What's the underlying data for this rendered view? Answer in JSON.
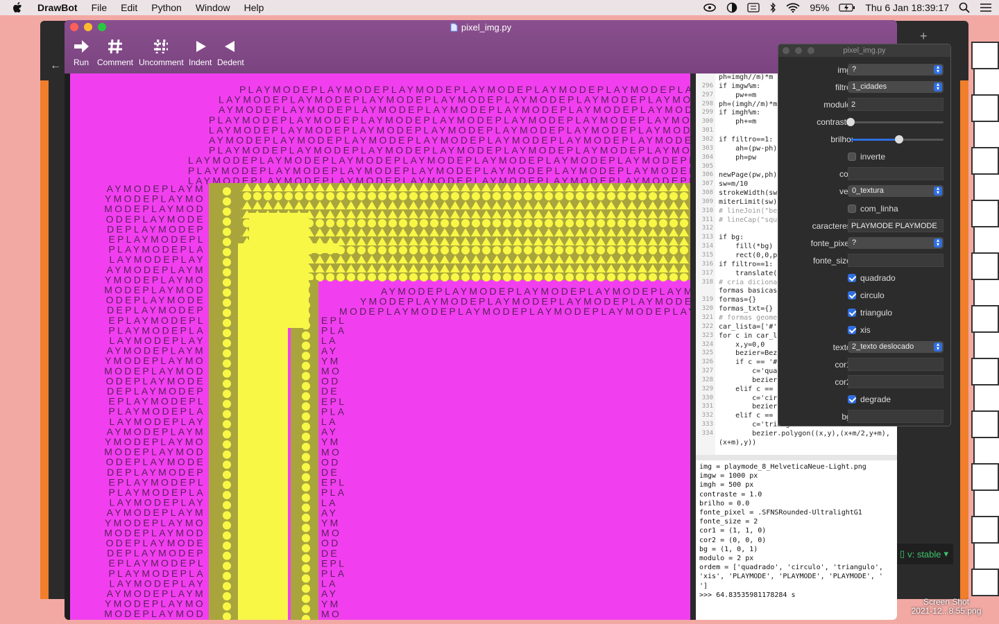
{
  "menubar": {
    "app": "DrawBot",
    "items": [
      "File",
      "Edit",
      "Python",
      "Window",
      "Help"
    ],
    "battery": "95%",
    "clock": "Thu 6 Jan  18:39:17"
  },
  "window": {
    "title": "pixel_img.py",
    "toolbar": [
      {
        "label": "Run",
        "icon": "run-arrow-icon"
      },
      {
        "label": "Comment",
        "icon": "hash-icon"
      },
      {
        "label": "Uncomment",
        "icon": "uncomment-hash-icon"
      },
      {
        "label": "Indent",
        "icon": "indent-triangle-icon"
      },
      {
        "label": "Dedent",
        "icon": "dedent-triangle-icon"
      }
    ]
  },
  "canvas": {
    "text": "PLAYMODE",
    "bg_color": "#f13ff0",
    "shape_color": "#f8f746",
    "olive": "#a9a53c"
  },
  "editor": {
    "line_numbers": [
      "",
      "296",
      "297",
      "298",
      "299",
      "300",
      "301",
      "302",
      "303",
      "304",
      "305",
      "306",
      "307",
      "308",
      "309",
      "310",
      "311",
      "312",
      "313",
      "314",
      "315",
      "316",
      "317",
      "318",
      "",
      "319",
      "320",
      "321",
      "322",
      "323",
      "324",
      "325",
      "326",
      "327",
      "328",
      "329",
      "330",
      "331",
      "332",
      "333",
      "334",
      ""
    ],
    "lines": [
      "ph=imgh//m)*m",
      "if imgw%m:",
      "    pw+=m",
      "ph=(imgh//m)*m",
      "if imgh%m:",
      "    ph+=m",
      "",
      "if filtro==1:",
      "    ah=(pw-ph)",
      "    ph=pw",
      "",
      "newPage(pw,ph)",
      "sw=m/10",
      "strokeWidth(sw",
      "miterLimit(sw)",
      "# lineJoin(\"be",
      "# lineCap(\"squ",
      "",
      "if bg:",
      "    fill(*bg)",
      "    rect(0,0,p",
      "if filtro==1:",
      "    translate(",
      "# cria diciona",
      "formas basicas",
      "formas={}",
      "formas_txt={}",
      "# formas geome",
      "car_lista=['#'",
      "for c in car_l",
      "    x,y=0,0",
      "    bezier=Bez",
      "    if c == '#",
      "        c='qua",
      "        bezier",
      "    elif c ==",
      "        c='cir",
      "        bezier",
      "    elif c ==",
      "        c='triangulo'",
      "        bezier.polygon((x,y),(x+m/2,y+m),",
      "(x+m),y))"
    ]
  },
  "output": [
    "img = playmode_8_HelveticaNeue-Light.png",
    "imgw = 1000 px",
    "imgh = 500 px",
    "contraste = 1.0",
    "brilho = 0.0",
    "fonte_pixel = .SFNSRounded-UltralightG1",
    "fonte_size = 2",
    "cor1 = (1, 1, 0)",
    "cor2 = (0, 0, 0)",
    "bg = (1, 0, 1)",
    "modulo = 2 px",
    "ordem = ['quadrado', 'circulo', 'triangulo',",
    "'xis', 'PLAYMODE', 'PLAYMODE', 'PLAYMODE', '",
    "']",
    ">>> 64.83535981178284 s"
  ],
  "panel": {
    "title": "pixel_img.py",
    "img_label": "img:",
    "img_value": "?",
    "filtro_label": "filtro:",
    "filtro_value": "1_cidades",
    "modulo_label": "modulo:",
    "modulo_value": "2",
    "contraste_label": "contraste:",
    "contraste_level": 0.0,
    "brilho_label": "brilho:",
    "brilho_level": 0.52,
    "inverte_label": "inverte",
    "inverte_checked": false,
    "cor_label": "cor:",
    "cor_value": "",
    "ver_label": "ver:",
    "ver_value": "0_textura",
    "com_linha_label": "com_linha",
    "com_linha_checked": false,
    "caracteres_label": "caracteres:",
    "caracteres_value": "PLAYMODE PLAYMODE",
    "fonte_pixel_label": "fonte_pixel:",
    "fonte_pixel_value": "?",
    "fonte_size_label": "fonte_size:",
    "fonte_size_value": "",
    "quadrado_label": "quadrado",
    "quadrado_checked": true,
    "circulo_label": "circulo",
    "circulo_checked": true,
    "triangulo_label": "triangulo",
    "triangulo_checked": true,
    "xis_label": "xis",
    "xis_checked": true,
    "texto_label": "texto:",
    "texto_value": "2_texto deslocado",
    "cor1_label": "cor1:",
    "cor1_value": "",
    "cor2_label": "cor2:",
    "cor2_value": "",
    "degrade_label": "degrade",
    "degrade_checked": true,
    "bg_label": "bg:",
    "bg_value": ""
  },
  "background": {
    "status_badge": "v: stable",
    "desktop_label_1": "Screen Shot",
    "desktop_label_2": "2021-12...8.55.png"
  }
}
